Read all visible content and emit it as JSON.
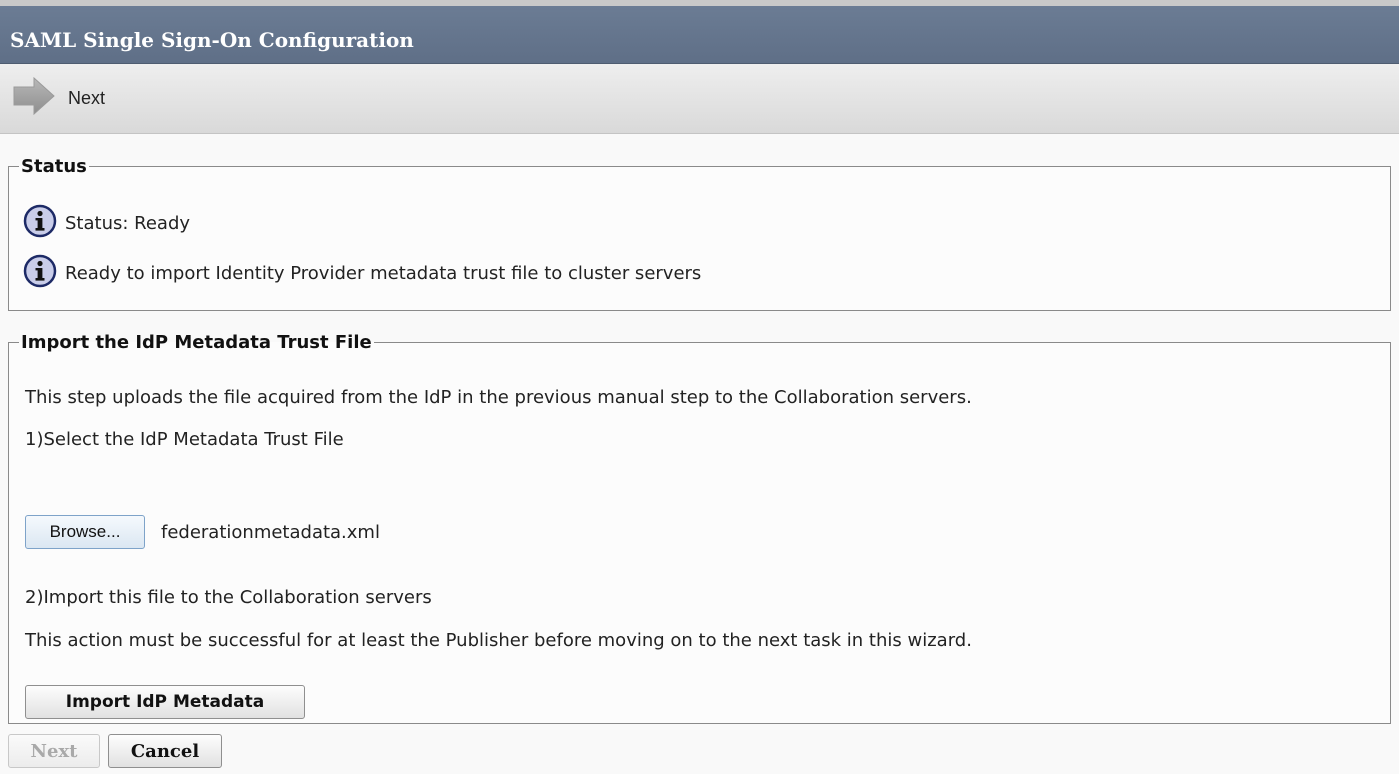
{
  "window": {
    "title": "SAML Single Sign-On Configuration"
  },
  "toolbar": {
    "next_label": "Next",
    "next_icon": "arrow-right-icon"
  },
  "status_section": {
    "legend": "Status",
    "messages": [
      {
        "icon": "info-icon",
        "text": "Status: Ready"
      },
      {
        "icon": "info-icon",
        "text": "Ready to import Identity Provider metadata trust file to cluster servers"
      }
    ]
  },
  "import_section": {
    "legend": "Import the IdP Metadata Trust File",
    "description": "This step uploads the file acquired from the IdP in the previous manual step to the Collaboration servers.",
    "step1": "1)Select the IdP Metadata Trust File",
    "browse_label": "Browse...",
    "selected_file": "federationmetadata.xml",
    "step2": "2)Import this file to the Collaboration servers",
    "note": "This action must be successful for at least the Publisher before moving on to the next task in this wizard.",
    "import_button_label": "Import IdP Metadata"
  },
  "footer": {
    "next_label": "Next",
    "next_disabled": true,
    "cancel_label": "Cancel"
  },
  "colors": {
    "title_bar": "#5f6f87",
    "title_text": "#ffffff",
    "info_icon_fill": "#c9cde9",
    "disabled_text": "#a9a9a9"
  }
}
